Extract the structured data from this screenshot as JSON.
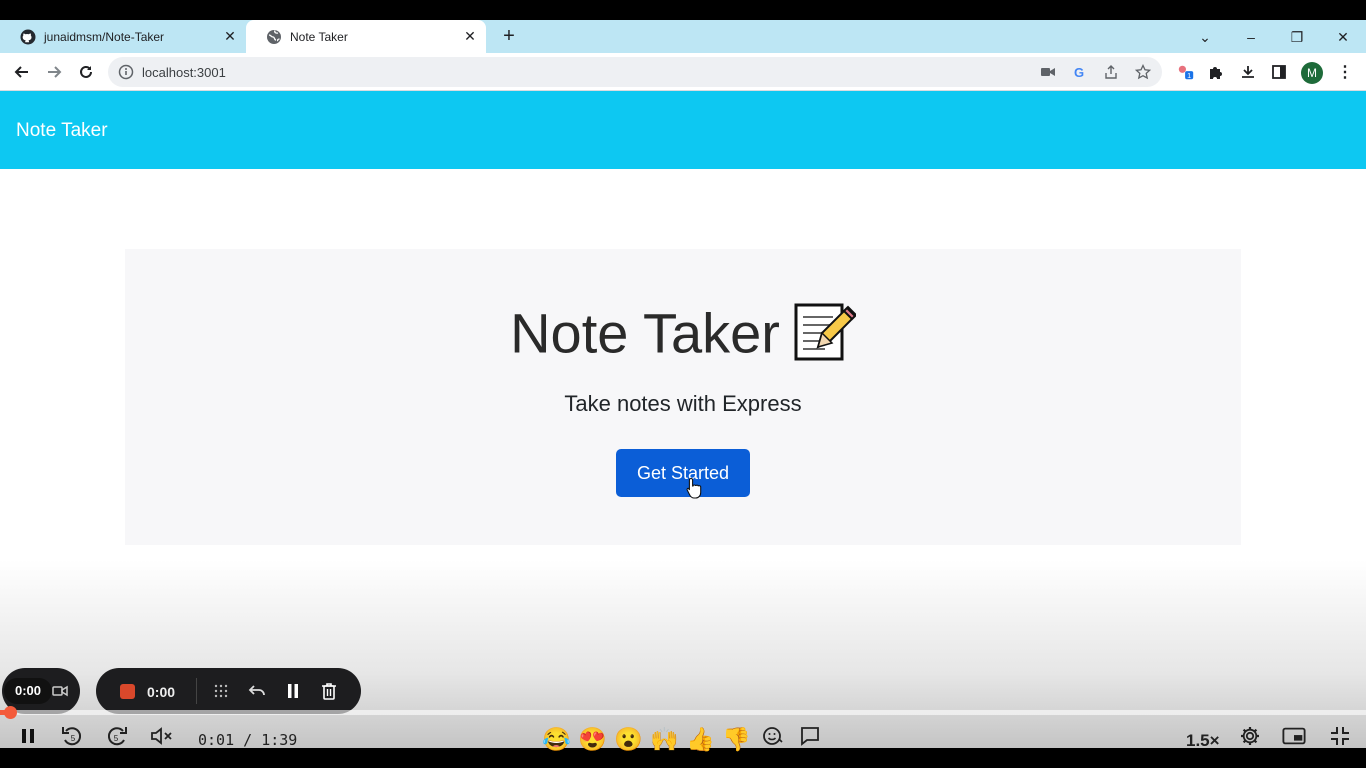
{
  "browser": {
    "tabs": [
      {
        "title": "junaidmsm/Note-Taker",
        "favicon": "github-icon",
        "active": false
      },
      {
        "title": "Note Taker",
        "favicon": "globe-icon",
        "active": true
      }
    ],
    "url": "localhost:3001",
    "profile_initial": "M"
  },
  "navbar": {
    "brand": "Note Taker",
    "color": "#0dc8f2"
  },
  "hero": {
    "title": "Note Taker",
    "title_emoji": "📝",
    "subtitle": "Take notes with Express",
    "button_label": "Get Started",
    "button_color": "#0b5ed7"
  },
  "recorder": {
    "camera_time": "0:00",
    "recording_time": "0:00"
  },
  "player": {
    "current_time": "0:01",
    "separator": "/",
    "duration": "1:39",
    "time_display": "0:01 / 1:39",
    "progress": 0.01,
    "speed": "1.5×",
    "reactions": [
      "😂",
      "😍",
      "😮",
      "🙌",
      "👍",
      "👎"
    ],
    "accent": "#f45b3b"
  }
}
